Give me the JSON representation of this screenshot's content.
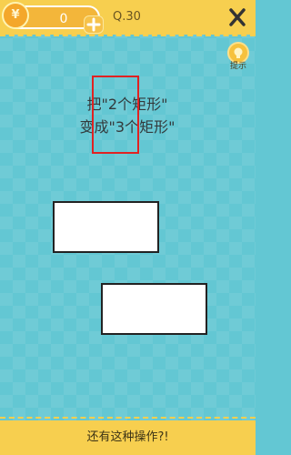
{
  "header": {
    "coin_symbol": "¥",
    "coin_count": "0",
    "level": "Q.30",
    "close_label": "X"
  },
  "hint": {
    "label": "提示"
  },
  "question": {
    "line1": "把\"2个矩形\"",
    "line2": "变成\"3个矩形\""
  },
  "footer": {
    "label": "还有这种操作?!"
  },
  "colors": {
    "background": "#63c7d3",
    "bar": "#f7cf4f",
    "highlight": "#e02222",
    "rectangle_fill": "#ffffff",
    "rectangle_border": "#222222"
  }
}
